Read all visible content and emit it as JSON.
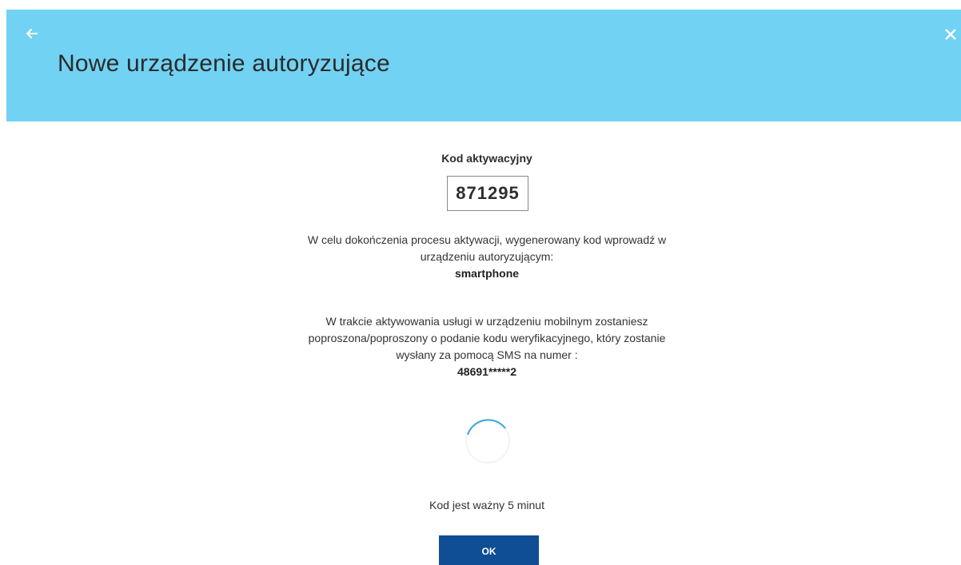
{
  "header": {
    "title": "Nowe urządzenie autoryzujące",
    "back_icon": "arrow-left-icon",
    "close_icon": "close-icon",
    "background_color": "#72d2f3"
  },
  "activation": {
    "code_label": "Kod aktywacyjny",
    "code_value": "871295"
  },
  "instructions": {
    "line1": "W celu dokończenia procesu aktywacji, wygenerowany kod wprowadź w",
    "line2": "urządzeniu autoryzującym:",
    "device_name": "smartphone"
  },
  "sms_info": {
    "line1": "W trakcie aktywowania usługi w urządzeniu mobilnym zostaniesz",
    "line2": "poproszona/poproszony o podanie kodu weryfikacyjnego, który zostanie",
    "line3": "wysłany za pomocą SMS na numer :",
    "phone_number": "48691*****2"
  },
  "spinner": {
    "icon": "loading-spinner-icon"
  },
  "validity": {
    "text": "Kod jest ważny 5 minut"
  },
  "actions": {
    "ok_label": "OK",
    "ok_color": "#0f4d94"
  }
}
